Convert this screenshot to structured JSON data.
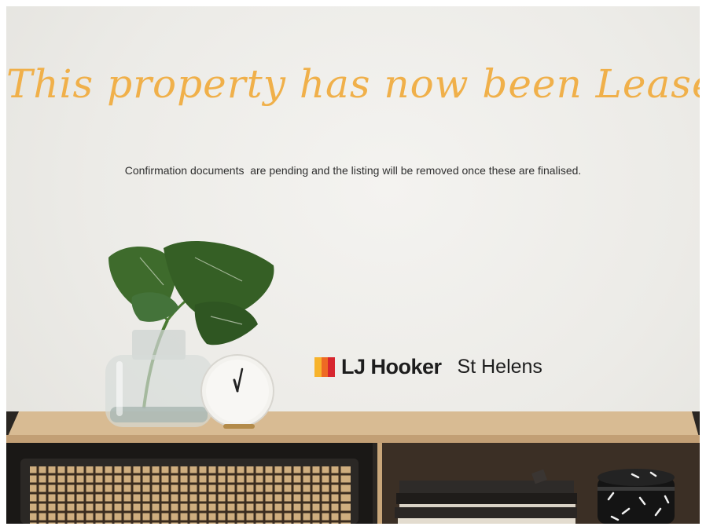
{
  "notice": {
    "headline": "This property has now been Leased",
    "message": "Confirmation documents  are pending and the listing will be removed once these are finalised."
  },
  "brand": {
    "name": "LJ Hooker",
    "office": "St Helens",
    "logo_colors": [
      "#f7b32b",
      "#ee6a24",
      "#d7262f"
    ]
  },
  "colors": {
    "accent": "#f0b04a",
    "text": "#2f2f2f",
    "wall": "#eeede9",
    "wood": "#d2b38a",
    "leaf": "#3d6b2e"
  },
  "scene": {
    "objects": [
      "monstera-plant",
      "glass-vase",
      "marble-clock",
      "wooden-sideboard",
      "rattan-door",
      "stacked-books",
      "black-patterned-jar"
    ]
  }
}
